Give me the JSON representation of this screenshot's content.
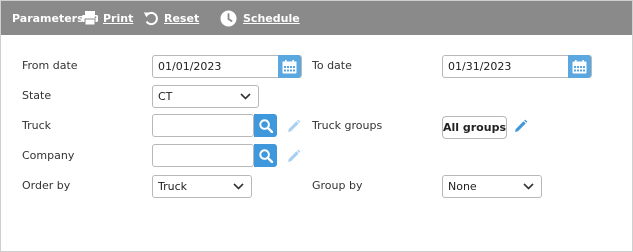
{
  "toolbar": {
    "title": "Parameters",
    "print_label": "Print",
    "reset_label": "Reset",
    "schedule_label": "Schedule"
  },
  "form": {
    "from_date": {
      "label": "From date",
      "value": "01/01/2023"
    },
    "to_date": {
      "label": "To date",
      "value": "01/31/2023"
    },
    "state": {
      "label": "State",
      "value": "CT"
    },
    "truck": {
      "label": "Truck",
      "value": ""
    },
    "truck_groups": {
      "label": "Truck groups",
      "button_label": "All groups"
    },
    "company": {
      "label": "Company",
      "value": ""
    },
    "order_by": {
      "label": "Order by",
      "value": "Truck"
    },
    "group_by": {
      "label": "Group by",
      "value": "None"
    }
  },
  "colors": {
    "toolbar_bg": "#8a8a8a",
    "calendar_btn": "#5ba7e0",
    "search_btn": "#3f98dc",
    "pencil_active": "#3f98dc",
    "pencil_disabled": "#a9d0ef"
  }
}
